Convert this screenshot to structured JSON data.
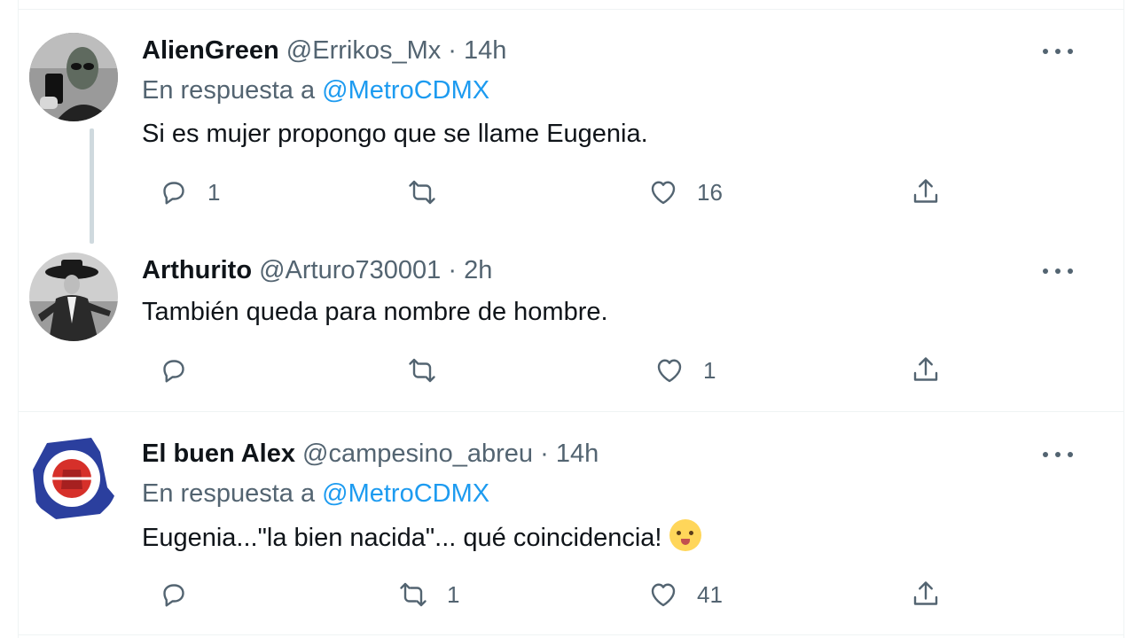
{
  "tweets": [
    {
      "name": "AlienGreen",
      "handle": "@Errikos_Mx",
      "separator": "·",
      "time": "14h",
      "reply_prefix": "En respuesta a",
      "reply_to": "@MetroCDMX",
      "text": "Si es mujer propongo que se llame Eugenia.",
      "replies": "1",
      "retweets": "",
      "likes": "16",
      "avatar_icon": "alien-avatar-icon"
    },
    {
      "name": "Arthurito",
      "handle": "@Arturo730001",
      "separator": "·",
      "time": "2h",
      "text": "También queda para nombre de hombre.",
      "replies": "",
      "retweets": "",
      "likes": "1",
      "avatar_icon": "hat-man-avatar-icon"
    },
    {
      "name": "El buen Alex",
      "handle": "@campesino_abreu",
      "separator": "·",
      "time": "14h",
      "reply_prefix": "En respuesta a",
      "reply_to": "@MetroCDMX",
      "text": "Eugenia...\"la bien nacida\"... qué coincidencia!",
      "emoji": "baby-face-emoji",
      "replies": "",
      "retweets": "1",
      "likes": "41",
      "avatar_icon": "crest-avatar-icon"
    }
  ],
  "colors": {
    "text_primary": "#0f1419",
    "text_secondary": "#536471",
    "accent": "#1d9bf0",
    "divider": "#eff3f4",
    "thread_line": "#cfd9de"
  }
}
